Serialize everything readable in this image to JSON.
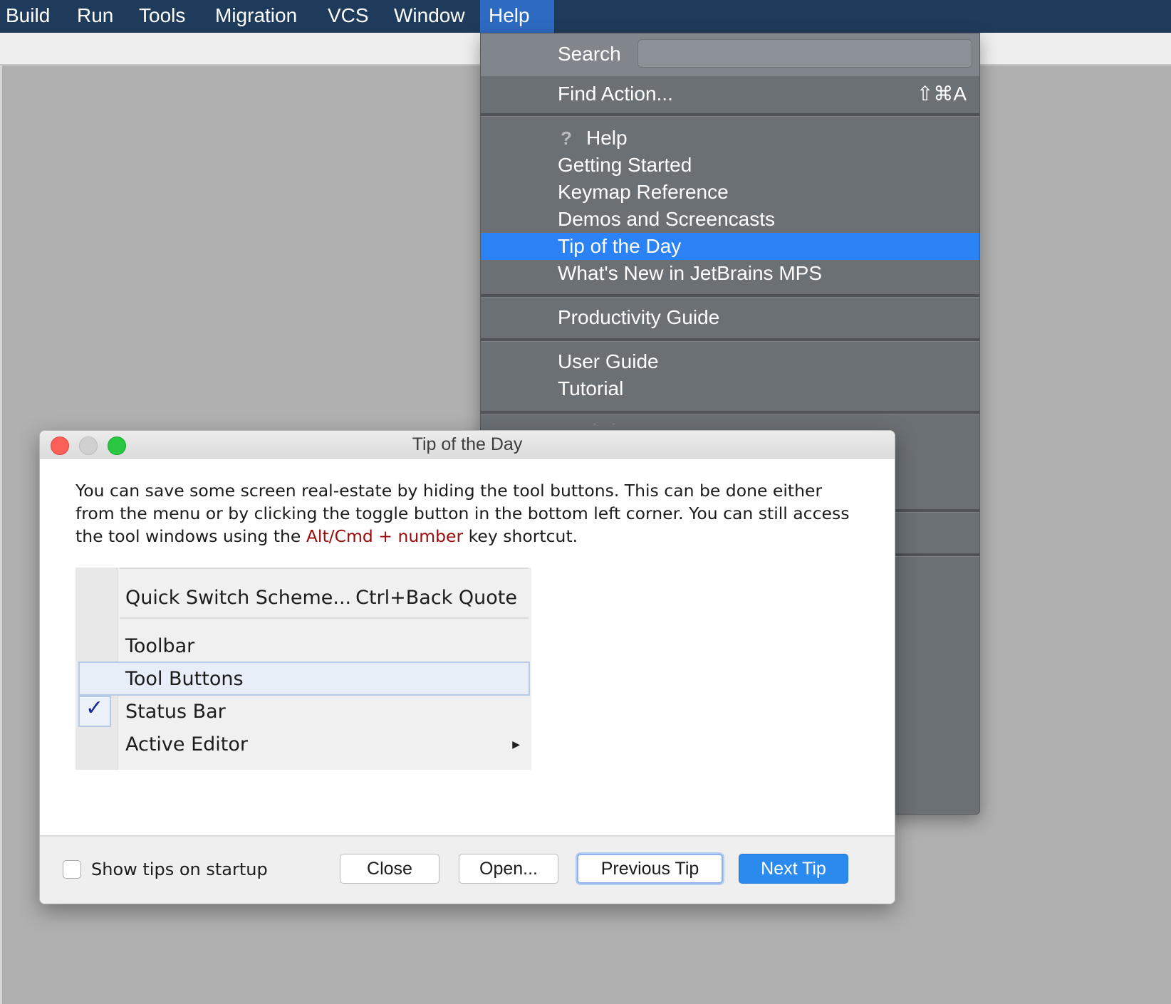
{
  "menubar": {
    "items": [
      "Build",
      "Run",
      "Tools",
      "Migration",
      "VCS",
      "Window",
      "Help"
    ],
    "active": "Help"
  },
  "help_menu": {
    "search_label": "Search",
    "search_value": "",
    "find_action": {
      "label": "Find Action...",
      "shortcut": "⇧⌘A"
    },
    "help_label": "Help",
    "items_group1": [
      "Getting Started",
      "Keymap Reference",
      "Demos and Screencasts",
      "Tip of the Day",
      "What's New in JetBrains MPS"
    ],
    "highlighted": "Tip of the Day",
    "productivity_guide": "Productivity Guide",
    "items_group2": [
      "User Guide",
      "Tutorial"
    ],
    "partial_item": "MPS U..."
  },
  "dialog": {
    "title": "Tip of the Day",
    "tip_text_before": "You can save some screen real-estate by hiding the tool buttons. This can be done either from the menu or by clicking the toggle button in the bottom left corner. You can still access the tool windows using the ",
    "tip_text_highlight": "Alt/Cmd + number",
    "tip_text_after": " key shortcut.",
    "mock_menu": {
      "quick_switch_label": "Quick Switch Scheme...",
      "quick_switch_shortcut": "Ctrl+Back Quote",
      "toolbar": "Toolbar",
      "tool_buttons": "Tool Buttons",
      "status_bar": "Status Bar",
      "active_editor": "Active Editor"
    },
    "footer": {
      "show_tips_label": "Show tips on startup",
      "close_button": "Close",
      "open_button": "Open...",
      "previous_button": "Previous Tip",
      "next_button": "Next Tip"
    }
  },
  "colors": {
    "menubar_bg": "#1f3b5c",
    "menu_bg": "#6b7075",
    "highlight": "#2b82f4",
    "next_button": "#2b8aee",
    "shortcut_text": "#9b0a0a"
  }
}
